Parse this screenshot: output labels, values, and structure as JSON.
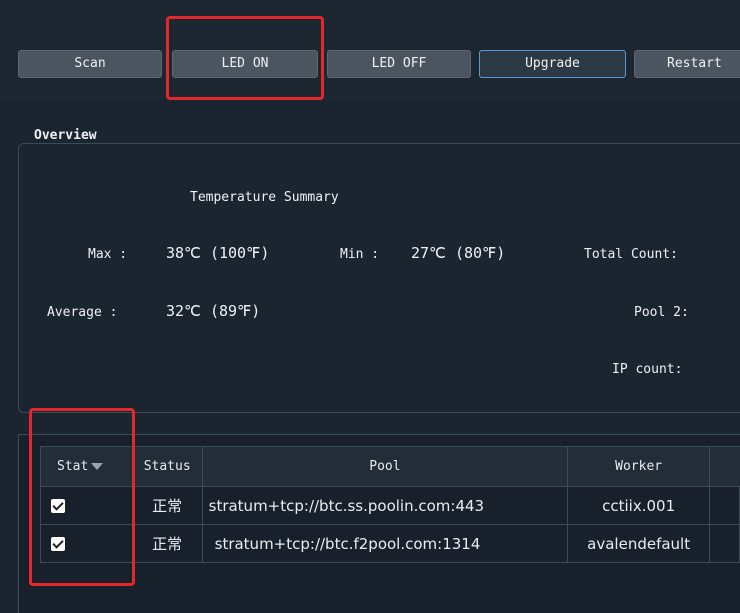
{
  "toolbar": {
    "scan": "Scan",
    "led_on": "LED ON",
    "led_off": "LED OFF",
    "upgrade": "Upgrade",
    "restart": "Restart"
  },
  "overview": {
    "title": "Overview",
    "temp_heading": "Temperature Summary",
    "max_label": "Max :",
    "max_value": "38℃ (100℉)",
    "min_label": "Min :",
    "min_value": "27℃ (80℉)",
    "avg_label": "Average :",
    "avg_value": "32℃ (89℉)",
    "total_count_label": "Total Count:",
    "pool2_label": "Pool 2:",
    "ip_count_label": "IP count:"
  },
  "table": {
    "headers": [
      "Stat",
      "Status",
      "Pool",
      "Worker"
    ],
    "rows": [
      {
        "status": "正常",
        "pool": "stratum+tcp://btc.ss.poolin.com:443",
        "worker": "cctiix.001"
      },
      {
        "status": "正常",
        "pool": "stratum+tcp://btc.f2pool.com:1314",
        "worker": "avalendefault"
      }
    ]
  },
  "colors": {
    "highlight": "#e5262a",
    "primary_border": "#5b9bd5"
  },
  "icons": [
    "sort-down-icon",
    "checkbox-checked-icon"
  ]
}
